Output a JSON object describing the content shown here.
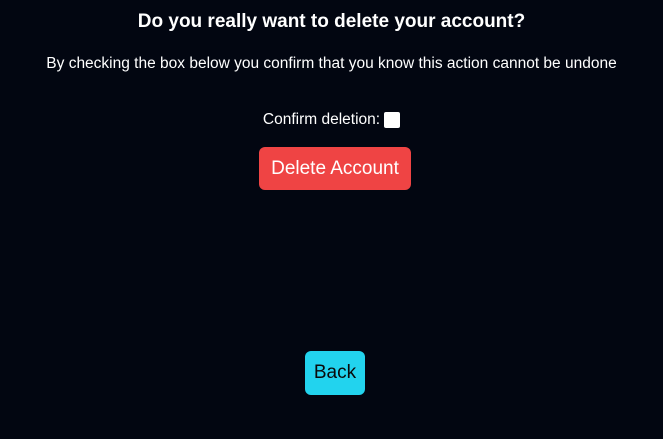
{
  "dialog": {
    "title": "Do you really want to delete your account?",
    "subtitle": "By checking the box below you confirm that you know this action cannot be undone",
    "confirm_label": "Confirm deletion:",
    "confirm_checked": false,
    "delete_label": "Delete Account",
    "back_label": "Back"
  },
  "colors": {
    "background": "#020611",
    "delete_button": "#ef4444",
    "back_button": "#22d3ee",
    "text": "#ffffff"
  }
}
